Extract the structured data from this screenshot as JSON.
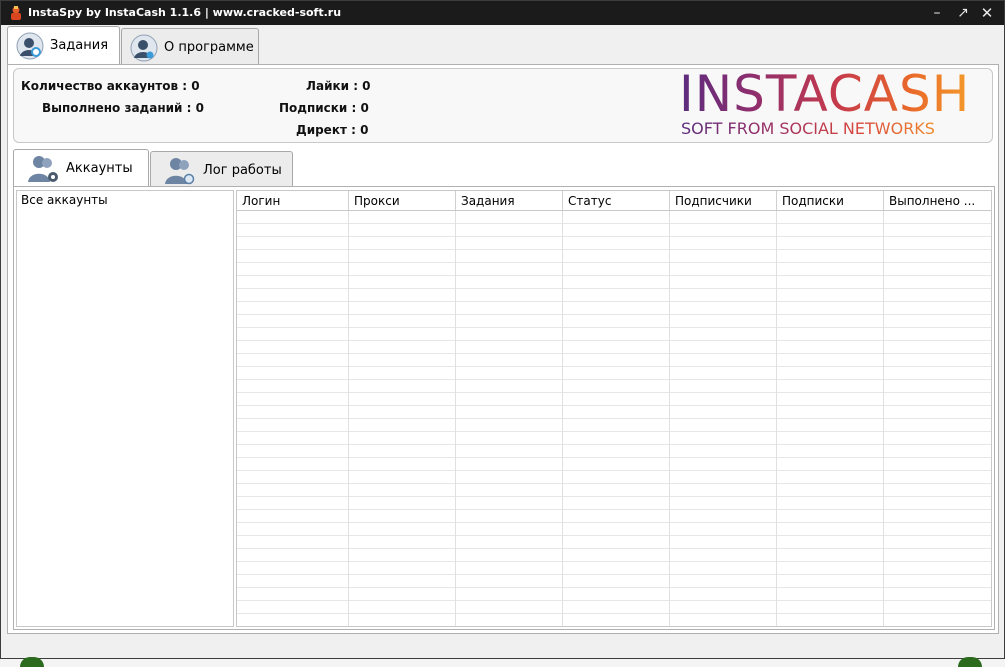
{
  "window": {
    "title": "InstaSpy by InstaCash 1.1.6 | www.cracked-soft.ru",
    "minimize_glyph": "–",
    "maximize_glyph": "↗",
    "close_glyph": "✕"
  },
  "top_tabs": [
    {
      "label": "Задания",
      "icon": "user-search-icon",
      "active": true
    },
    {
      "label": "О программе",
      "icon": "user-info-icon",
      "active": false
    }
  ],
  "stats": {
    "accounts": "Количество аккаунтов : 0",
    "tasks_done": "Выполнено заданий : 0",
    "likes": "Лайки : 0",
    "follows": "Подписки : 0",
    "direct": "Директ : 0"
  },
  "logo": {
    "title": "INSTACASH",
    "subtitle": "SOFT FROM SOCIAL NETWORKS"
  },
  "inner_tabs": [
    {
      "label": "Аккаунты",
      "icon": "users-gear-icon",
      "active": true
    },
    {
      "label": "Лог работы",
      "icon": "users-search-icon",
      "active": false
    }
  ],
  "accounts_tree": {
    "root": "Все аккаунты"
  },
  "grid": {
    "columns": [
      "Логин",
      "Прокси",
      "Задания",
      "Статус",
      "Подписчики",
      "Подписки",
      "Выполнено ..."
    ]
  },
  "colors": {
    "titlebar": "#1b1b1b",
    "logo_gradient_start": "#5b2c7e",
    "logo_gradient_end": "#f39a2a"
  }
}
